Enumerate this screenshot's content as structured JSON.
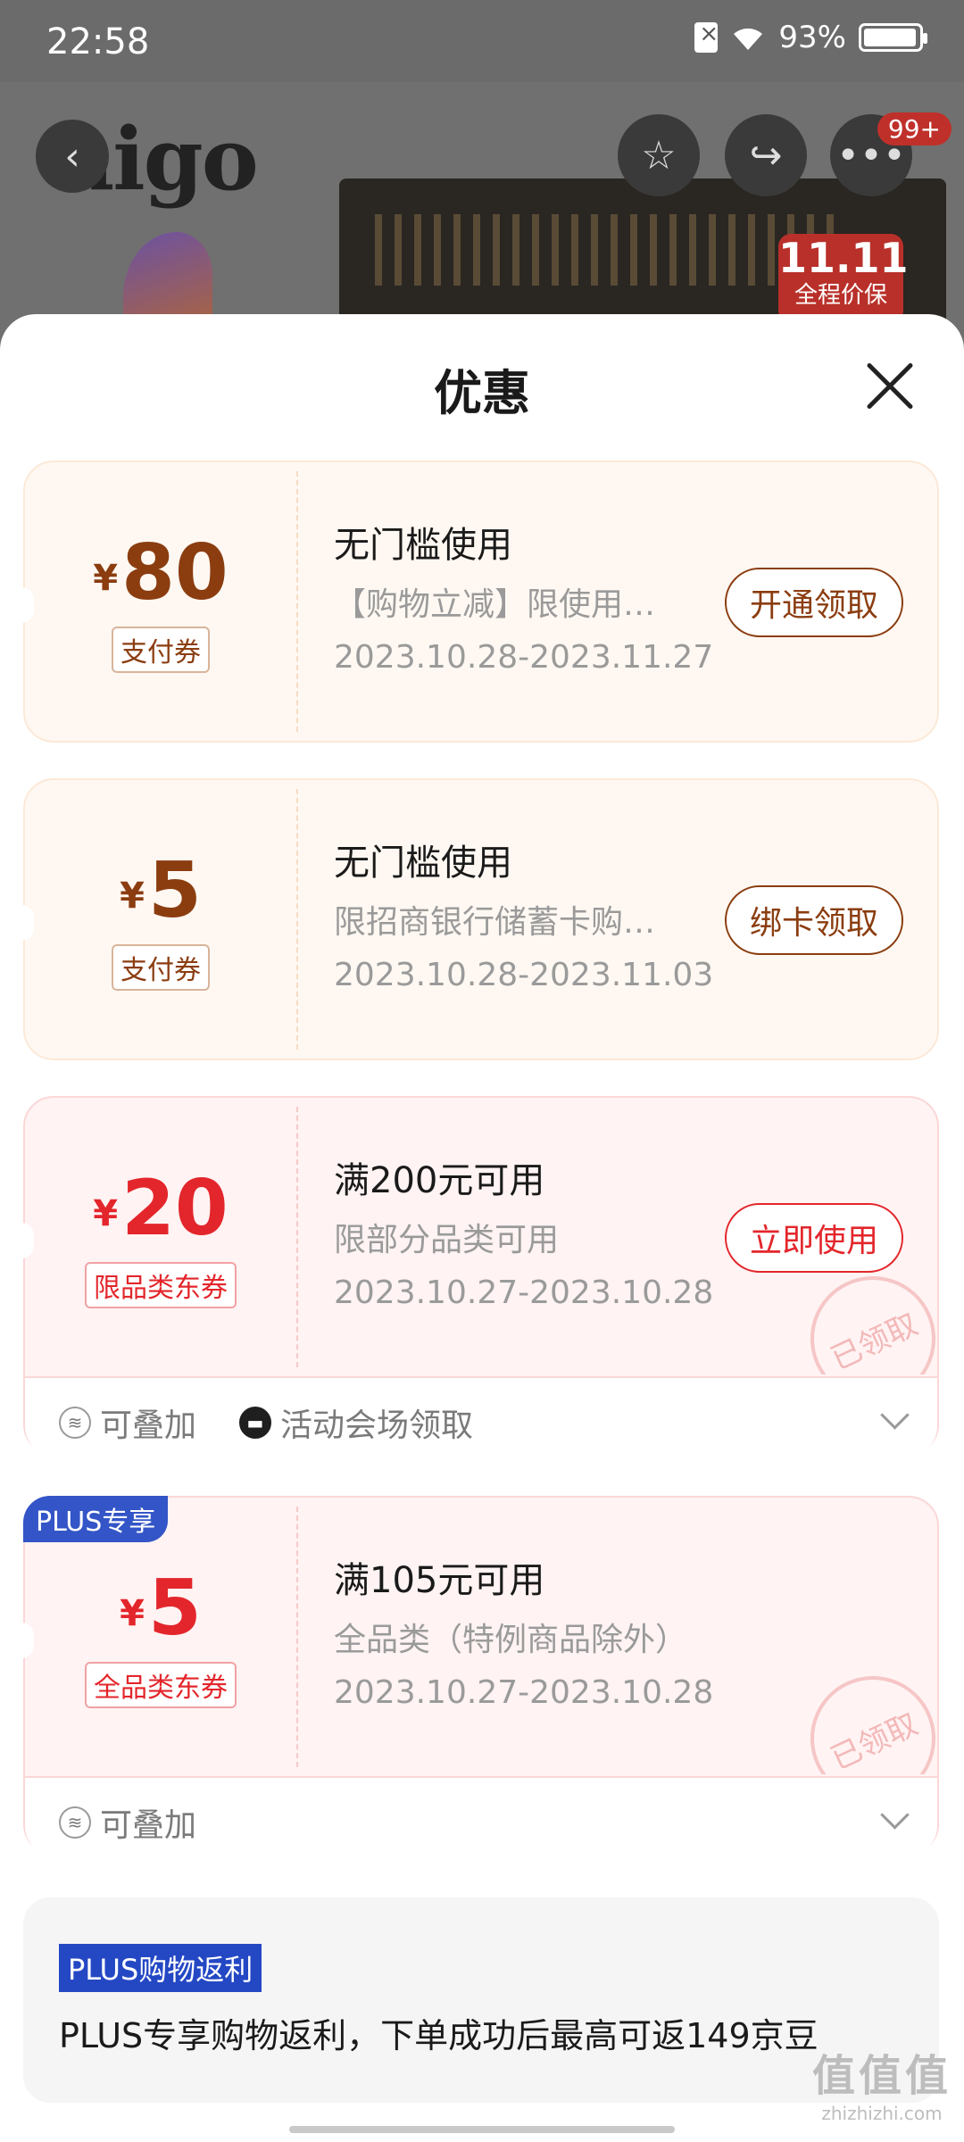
{
  "status_bar": {
    "time": "22:58",
    "battery": "93%"
  },
  "background": {
    "logo": "aigo",
    "notification_badge": "99+",
    "promo_badge": "11.11",
    "promo_sub": "全程价保"
  },
  "sheet": {
    "title": "优惠"
  },
  "coupons": [
    {
      "currency": "¥",
      "amount": "80",
      "tag": "支付券",
      "title": "无门槛使用",
      "desc": "【购物立减】限使用…",
      "dates": "2023.10.28-2023.11.27",
      "action": "开通领取"
    },
    {
      "currency": "¥",
      "amount": "5",
      "tag": "支付券",
      "title": "无门槛使用",
      "desc": "限招商银行储蓄卡购…",
      "dates": "2023.10.28-2023.11.03",
      "action": "绑卡领取"
    },
    {
      "currency": "¥",
      "amount": "20",
      "tag": "限品类东券",
      "title": "满200元可用",
      "desc": "限部分品类可用",
      "dates": "2023.10.27-2023.10.28",
      "action": "立即使用",
      "stamp": "已领取",
      "footer": [
        "可叠加",
        "活动会场领取"
      ]
    },
    {
      "ribbon": "PLUS专享",
      "currency": "¥",
      "amount": "5",
      "tag": "全品类东券",
      "title": "满105元可用",
      "desc": "全品类（特例商品除外）",
      "dates": "2023.10.27-2023.10.28",
      "stamp": "已领取",
      "footer": [
        "可叠加"
      ]
    }
  ],
  "rebate": {
    "tag": "PLUS购物返利",
    "text": "PLUS专享购物返利，下单成功后最高可返149京豆"
  },
  "watermark": {
    "line1": "值值值",
    "line2": "zhizhizhi.com"
  }
}
